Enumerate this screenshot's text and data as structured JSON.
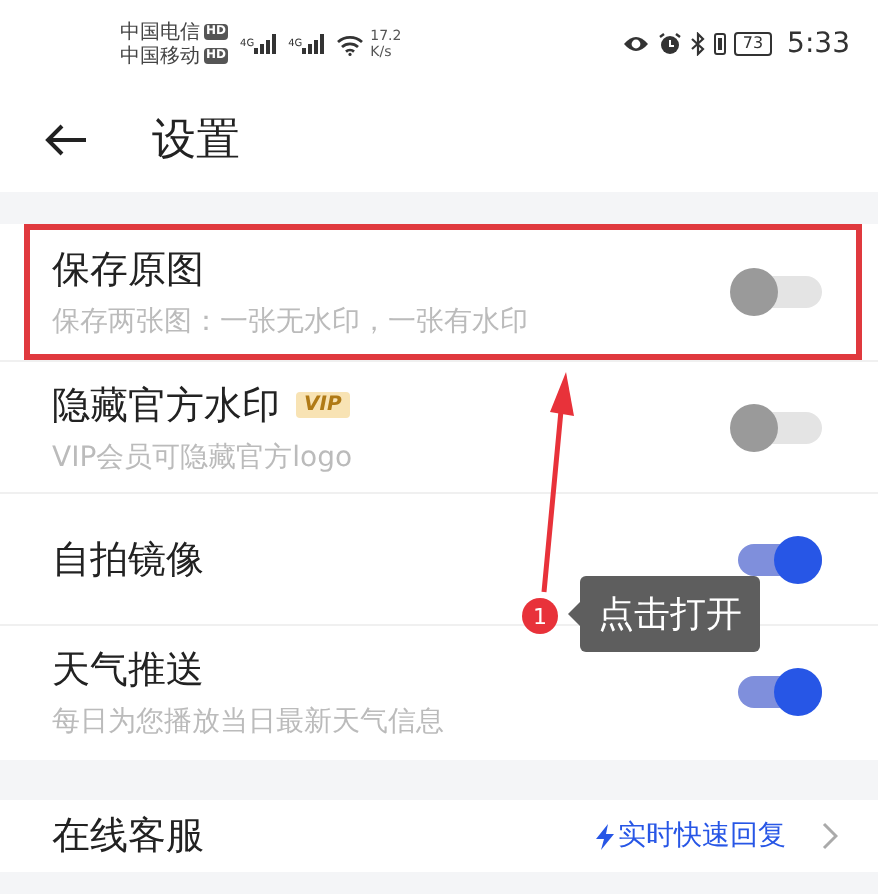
{
  "status_bar": {
    "carriers": [
      {
        "name": "中国电信",
        "badge": "HD"
      },
      {
        "name": "中国移动",
        "badge": "HD"
      }
    ],
    "signals": [
      {
        "label": "4G"
      },
      {
        "label": "4G"
      }
    ],
    "speed": {
      "value": "17.2",
      "unit": "K/s"
    },
    "battery": "73",
    "time": "5:33"
  },
  "header": {
    "title": "设置"
  },
  "settings": [
    {
      "title": "保存原图",
      "subtitle": "保存两张图：一张无水印，一张有水印",
      "on": false,
      "highlighted": true
    },
    {
      "title": "隐藏官方水印",
      "badge": "VIP",
      "subtitle": "VIP会员可隐藏官方logo",
      "on": false,
      "highlighted": false
    },
    {
      "title": "自拍镜像",
      "on": true,
      "highlighted": false
    },
    {
      "title": "天气推送",
      "subtitle": "每日为您播放当日最新天气信息",
      "on": true,
      "highlighted": false
    }
  ],
  "support": {
    "title": "在线客服",
    "value": "实时快速回复"
  },
  "annotation": {
    "step": "1",
    "tooltip": "点击打开"
  }
}
